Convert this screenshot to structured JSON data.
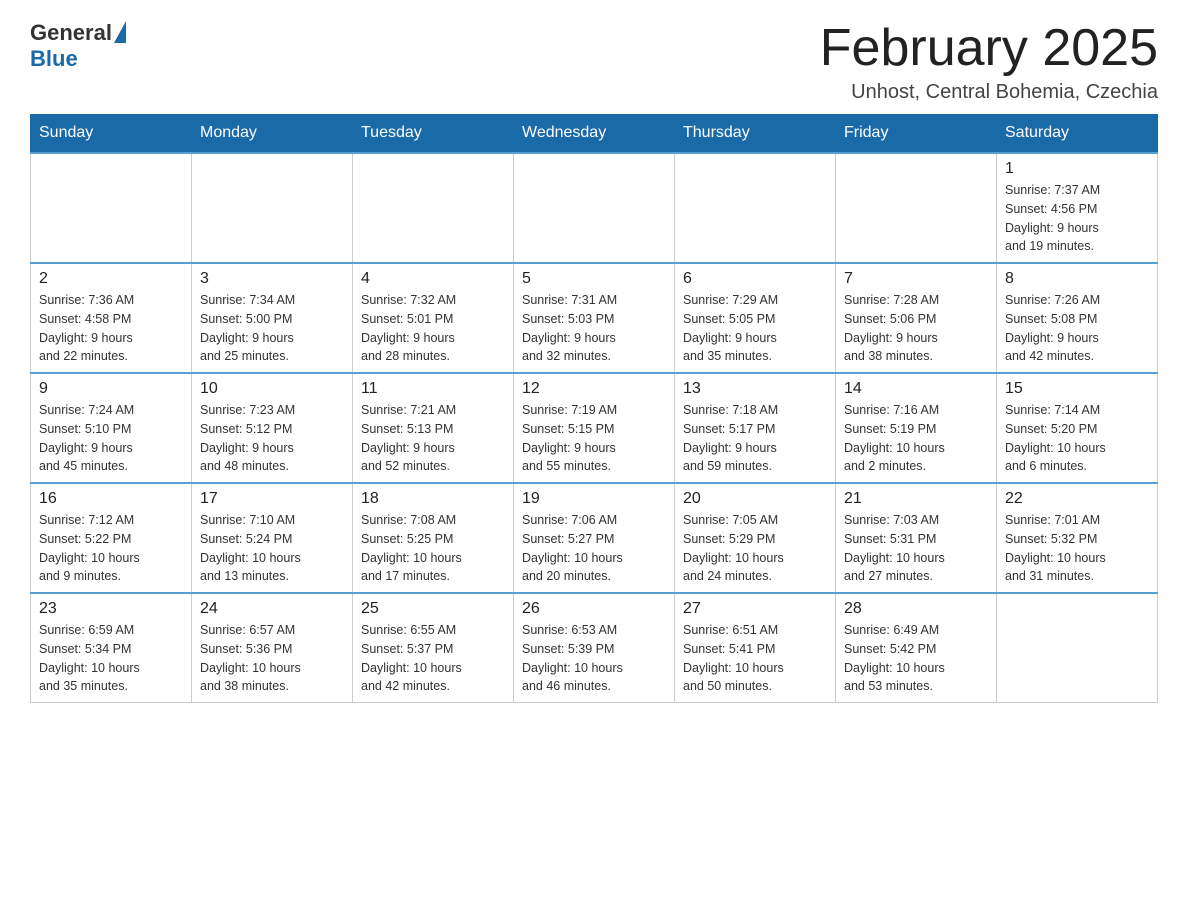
{
  "logo": {
    "general": "General",
    "blue": "Blue"
  },
  "header": {
    "title": "February 2025",
    "subtitle": "Unhost, Central Bohemia, Czechia"
  },
  "days_of_week": [
    "Sunday",
    "Monday",
    "Tuesday",
    "Wednesday",
    "Thursday",
    "Friday",
    "Saturday"
  ],
  "weeks": [
    {
      "days": [
        {
          "number": "",
          "info": ""
        },
        {
          "number": "",
          "info": ""
        },
        {
          "number": "",
          "info": ""
        },
        {
          "number": "",
          "info": ""
        },
        {
          "number": "",
          "info": ""
        },
        {
          "number": "",
          "info": ""
        },
        {
          "number": "1",
          "info": "Sunrise: 7:37 AM\nSunset: 4:56 PM\nDaylight: 9 hours\nand 19 minutes."
        }
      ]
    },
    {
      "days": [
        {
          "number": "2",
          "info": "Sunrise: 7:36 AM\nSunset: 4:58 PM\nDaylight: 9 hours\nand 22 minutes."
        },
        {
          "number": "3",
          "info": "Sunrise: 7:34 AM\nSunset: 5:00 PM\nDaylight: 9 hours\nand 25 minutes."
        },
        {
          "number": "4",
          "info": "Sunrise: 7:32 AM\nSunset: 5:01 PM\nDaylight: 9 hours\nand 28 minutes."
        },
        {
          "number": "5",
          "info": "Sunrise: 7:31 AM\nSunset: 5:03 PM\nDaylight: 9 hours\nand 32 minutes."
        },
        {
          "number": "6",
          "info": "Sunrise: 7:29 AM\nSunset: 5:05 PM\nDaylight: 9 hours\nand 35 minutes."
        },
        {
          "number": "7",
          "info": "Sunrise: 7:28 AM\nSunset: 5:06 PM\nDaylight: 9 hours\nand 38 minutes."
        },
        {
          "number": "8",
          "info": "Sunrise: 7:26 AM\nSunset: 5:08 PM\nDaylight: 9 hours\nand 42 minutes."
        }
      ]
    },
    {
      "days": [
        {
          "number": "9",
          "info": "Sunrise: 7:24 AM\nSunset: 5:10 PM\nDaylight: 9 hours\nand 45 minutes."
        },
        {
          "number": "10",
          "info": "Sunrise: 7:23 AM\nSunset: 5:12 PM\nDaylight: 9 hours\nand 48 minutes."
        },
        {
          "number": "11",
          "info": "Sunrise: 7:21 AM\nSunset: 5:13 PM\nDaylight: 9 hours\nand 52 minutes."
        },
        {
          "number": "12",
          "info": "Sunrise: 7:19 AM\nSunset: 5:15 PM\nDaylight: 9 hours\nand 55 minutes."
        },
        {
          "number": "13",
          "info": "Sunrise: 7:18 AM\nSunset: 5:17 PM\nDaylight: 9 hours\nand 59 minutes."
        },
        {
          "number": "14",
          "info": "Sunrise: 7:16 AM\nSunset: 5:19 PM\nDaylight: 10 hours\nand 2 minutes."
        },
        {
          "number": "15",
          "info": "Sunrise: 7:14 AM\nSunset: 5:20 PM\nDaylight: 10 hours\nand 6 minutes."
        }
      ]
    },
    {
      "days": [
        {
          "number": "16",
          "info": "Sunrise: 7:12 AM\nSunset: 5:22 PM\nDaylight: 10 hours\nand 9 minutes."
        },
        {
          "number": "17",
          "info": "Sunrise: 7:10 AM\nSunset: 5:24 PM\nDaylight: 10 hours\nand 13 minutes."
        },
        {
          "number": "18",
          "info": "Sunrise: 7:08 AM\nSunset: 5:25 PM\nDaylight: 10 hours\nand 17 minutes."
        },
        {
          "number": "19",
          "info": "Sunrise: 7:06 AM\nSunset: 5:27 PM\nDaylight: 10 hours\nand 20 minutes."
        },
        {
          "number": "20",
          "info": "Sunrise: 7:05 AM\nSunset: 5:29 PM\nDaylight: 10 hours\nand 24 minutes."
        },
        {
          "number": "21",
          "info": "Sunrise: 7:03 AM\nSunset: 5:31 PM\nDaylight: 10 hours\nand 27 minutes."
        },
        {
          "number": "22",
          "info": "Sunrise: 7:01 AM\nSunset: 5:32 PM\nDaylight: 10 hours\nand 31 minutes."
        }
      ]
    },
    {
      "days": [
        {
          "number": "23",
          "info": "Sunrise: 6:59 AM\nSunset: 5:34 PM\nDaylight: 10 hours\nand 35 minutes."
        },
        {
          "number": "24",
          "info": "Sunrise: 6:57 AM\nSunset: 5:36 PM\nDaylight: 10 hours\nand 38 minutes."
        },
        {
          "number": "25",
          "info": "Sunrise: 6:55 AM\nSunset: 5:37 PM\nDaylight: 10 hours\nand 42 minutes."
        },
        {
          "number": "26",
          "info": "Sunrise: 6:53 AM\nSunset: 5:39 PM\nDaylight: 10 hours\nand 46 minutes."
        },
        {
          "number": "27",
          "info": "Sunrise: 6:51 AM\nSunset: 5:41 PM\nDaylight: 10 hours\nand 50 minutes."
        },
        {
          "number": "28",
          "info": "Sunrise: 6:49 AM\nSunset: 5:42 PM\nDaylight: 10 hours\nand 53 minutes."
        },
        {
          "number": "",
          "info": ""
        }
      ]
    }
  ]
}
